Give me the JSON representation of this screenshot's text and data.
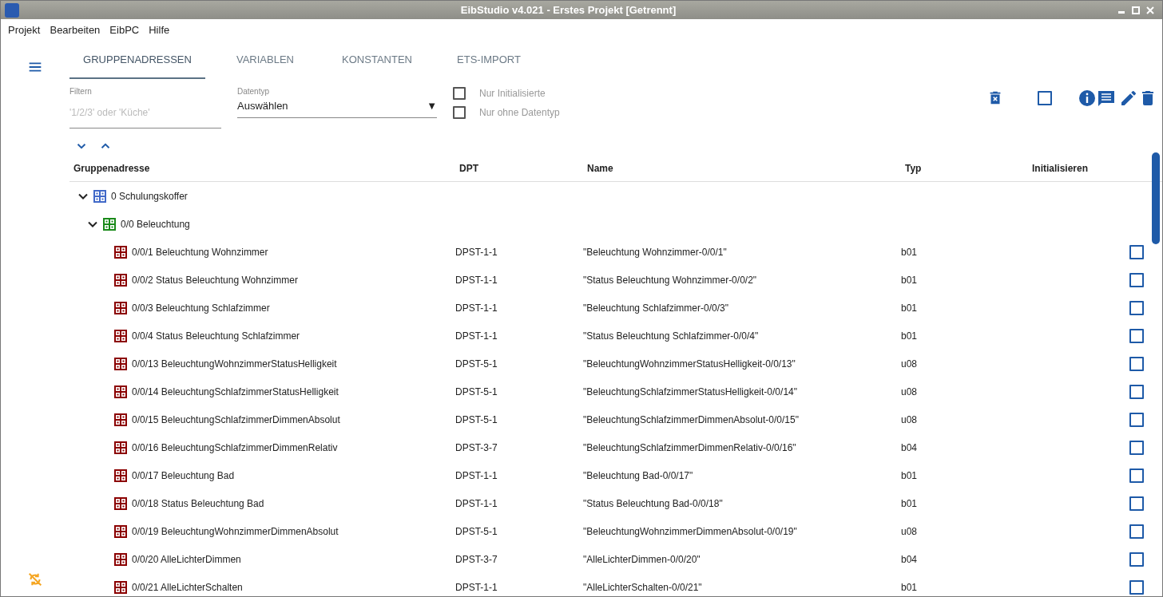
{
  "window": {
    "title": "EibStudio v4.021 - Erstes Projekt [Getrennt]"
  },
  "menu": [
    "Projekt",
    "Bearbeiten",
    "EibPC",
    "Hilfe"
  ],
  "tabs": [
    {
      "label": "GRUPPENADRESSEN",
      "selected": true
    },
    {
      "label": "VARIABLEN",
      "selected": false
    },
    {
      "label": "KONSTANTEN",
      "selected": false
    },
    {
      "label": "ETS-IMPORT",
      "selected": false
    }
  ],
  "filter": {
    "label": "Filtern",
    "placeholder": "'1/2/3' oder 'Küche'"
  },
  "datatype": {
    "label": "Datentyp",
    "value": "Auswählen",
    "arrow": "▼"
  },
  "options": [
    {
      "label": "Nur Initialisierte",
      "checked": false
    },
    {
      "label": "Nur ohne Datentyp",
      "checked": false
    }
  ],
  "select_all": {
    "checked": false
  },
  "table": {
    "columns": [
      "Gruppenadresse",
      "DPT",
      "Name",
      "Typ",
      "Initialisieren"
    ],
    "tree": [
      {
        "label": "0 Schulungskoffer",
        "expanded": true,
        "children": [
          {
            "label": "0/0 Beleuchtung",
            "expanded": true,
            "children": [
              {
                "label": "0/0/1 Beleuchtung Wohnzimmer",
                "dpt": "DPST-1-1",
                "name": "\"Beleuchtung Wohnzimmer-0/0/1\"",
                "typ": "b01",
                "initialize": false
              },
              {
                "label": "0/0/2 Status Beleuchtung Wohnzimmer",
                "dpt": "DPST-1-1",
                "name": "\"Status Beleuchtung Wohnzimmer-0/0/2\"",
                "typ": "b01",
                "initialize": false
              },
              {
                "label": "0/0/3 Beleuchtung Schlafzimmer",
                "dpt": "DPST-1-1",
                "name": "\"Beleuchtung Schlafzimmer-0/0/3\"",
                "typ": "b01",
                "initialize": false
              },
              {
                "label": "0/0/4 Status Beleuchtung Schlafzimmer",
                "dpt": "DPST-1-1",
                "name": "\"Status Beleuchtung Schlafzimmer-0/0/4\"",
                "typ": "b01",
                "initialize": false
              },
              {
                "label": "0/0/13 BeleuchtungWohnzimmerStatusHelligkeit",
                "dpt": "DPST-5-1",
                "name": "\"BeleuchtungWohnzimmerStatusHelligkeit-0/0/13\"",
                "typ": "u08",
                "initialize": false
              },
              {
                "label": "0/0/14 BeleuchtungSchlafzimmerStatusHelligkeit",
                "dpt": "DPST-5-1",
                "name": "\"BeleuchtungSchlafzimmerStatusHelligkeit-0/0/14\"",
                "typ": "u08",
                "initialize": false
              },
              {
                "label": "0/0/15 BeleuchtungSchlafzimmerDimmenAbsolut",
                "dpt": "DPST-5-1",
                "name": "\"BeleuchtungSchlafzimmerDimmenAbsolut-0/0/15\"",
                "typ": "u08",
                "initialize": false
              },
              {
                "label": "0/0/16 BeleuchtungSchlafzimmerDimmenRelativ",
                "dpt": "DPST-3-7",
                "name": "\"BeleuchtungSchlafzimmerDimmenRelativ-0/0/16\"",
                "typ": "b04",
                "initialize": false
              },
              {
                "label": "0/0/17 Beleuchtung Bad",
                "dpt": "DPST-1-1",
                "name": "\"Beleuchtung Bad-0/0/17\"",
                "typ": "b01",
                "initialize": false
              },
              {
                "label": "0/0/18 Status Beleuchtung Bad",
                "dpt": "DPST-1-1",
                "name": "\"Status Beleuchtung Bad-0/0/18\"",
                "typ": "b01",
                "initialize": false
              },
              {
                "label": "0/0/19 BeleuchtungWohnzimmerDimmenAbsolut",
                "dpt": "DPST-5-1",
                "name": "\"BeleuchtungWohnzimmerDimmenAbsolut-0/0/19\"",
                "typ": "u08",
                "initialize": false
              },
              {
                "label": "0/0/20 AlleLichterDimmen",
                "dpt": "DPST-3-7",
                "name": "\"AlleLichterDimmen-0/0/20\"",
                "typ": "b04",
                "initialize": false
              },
              {
                "label": "0/0/21 AlleLichterSchalten",
                "dpt": "DPST-1-1",
                "name": "\"AlleLichterSchalten-0/0/21\"",
                "typ": "b01",
                "initialize": false
              }
            ]
          }
        ]
      }
    ]
  }
}
